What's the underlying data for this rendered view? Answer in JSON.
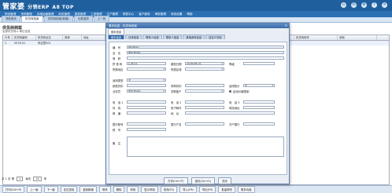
{
  "app": {
    "logo_main": "管家婆",
    "logo_sub": "分销ERP",
    "logo_tag": "A8 TOP"
  },
  "header_icons": [
    "home-icon",
    "mail-icon",
    "settings-icon",
    "help-icon",
    "close-icon"
  ],
  "menus": [
    "物流管理",
    "采购管理",
    "存储运输管理",
    "财务管理",
    "报表管理",
    "工资管理",
    "生产管理",
    "零售中心",
    "客户服务",
    "审批管理",
    "系统设置",
    "帮助"
  ],
  "tabs": [
    "导航首页",
    "供货商档案",
    "供货商档案(新增)",
    "分类选项",
    "上一张"
  ],
  "page": {
    "title": "供货商档案",
    "subtitle": "全部供货商 ▸ 单位信息"
  },
  "grid": {
    "columns": [
      "行号",
      "供货商编号",
      "供货商全名",
      "简称",
      "地址",
      "联系人",
      "电话",
      "手机",
      "传真",
      "开户银行",
      "银行账号",
      "供货商税号",
      "其他"
    ],
    "rows": [
      [
        "1",
        "0078-01",
        "来这里001"
      ]
    ]
  },
  "pager": {
    "label": "共 1 页 第",
    "page": "1",
    "size_label": "每页",
    "size": "24",
    "unit": "条"
  },
  "bottom_buttons": [
    "打印(Ctrl+P)",
    "上一级",
    "下一级",
    "定位查找",
    "复制新增",
    "修改",
    "删除",
    "停用",
    "显示停用",
    "查询(F5)",
    "导入(F8)",
    "导出(F9)",
    "批量修改",
    "更多功能"
  ],
  "modal": {
    "title": "基本信息 - 供货商档案",
    "top_tab": "基本信息",
    "inner_tabs": [
      "基本信息",
      "往来信息",
      "联系人信息",
      "联系人信息",
      "其他资料信息",
      "自定义字段"
    ],
    "fields": {
      "code_label": "编　号",
      "code_value": "0078-01",
      "name_label": "全　名",
      "name_value": "来这里001",
      "short_label": "简　称",
      "pinyin_label": "拼 音 码",
      "area_label": "所属地区",
      "area_value": "C78-01",
      "region_label": "所属区域",
      "date_label": "建档日期",
      "date_value": "2018-08-01",
      "rank_label": "等级",
      "status_label": "状态",
      "type_label": "适用类型",
      "type_value": "无",
      "sales_label": "销售折扣",
      "purchase_label": "采购折扣",
      "price_label": "适用售价",
      "price_value": "无",
      "staff_label": "业务员",
      "staff_value": "来这里001",
      "dept_label": "关联客户",
      "auto_label": "启用价格限制",
      "tel1_label": "电　话 1",
      "tel2_label": "电　话 2",
      "tel3_label": "电　话 3",
      "fax_label": "传　真",
      "email_label": "电子邮件",
      "web_label": "网站地址",
      "zip_label": "邮　编",
      "addr_label": "地　址",
      "bank_label": "银行账号",
      "bankname_label": "银行户名",
      "account_label": "开户银行",
      "tax_label": "税　号",
      "memo_label": "备　注"
    },
    "buttons": [
      "打印(Ctrl+P)",
      "保存(Ctrl+S)",
      "关闭"
    ]
  },
  "colors": {
    "header": "#1f5f9e",
    "menubar": "#2c70b4",
    "accent": "#2f6aa8"
  }
}
